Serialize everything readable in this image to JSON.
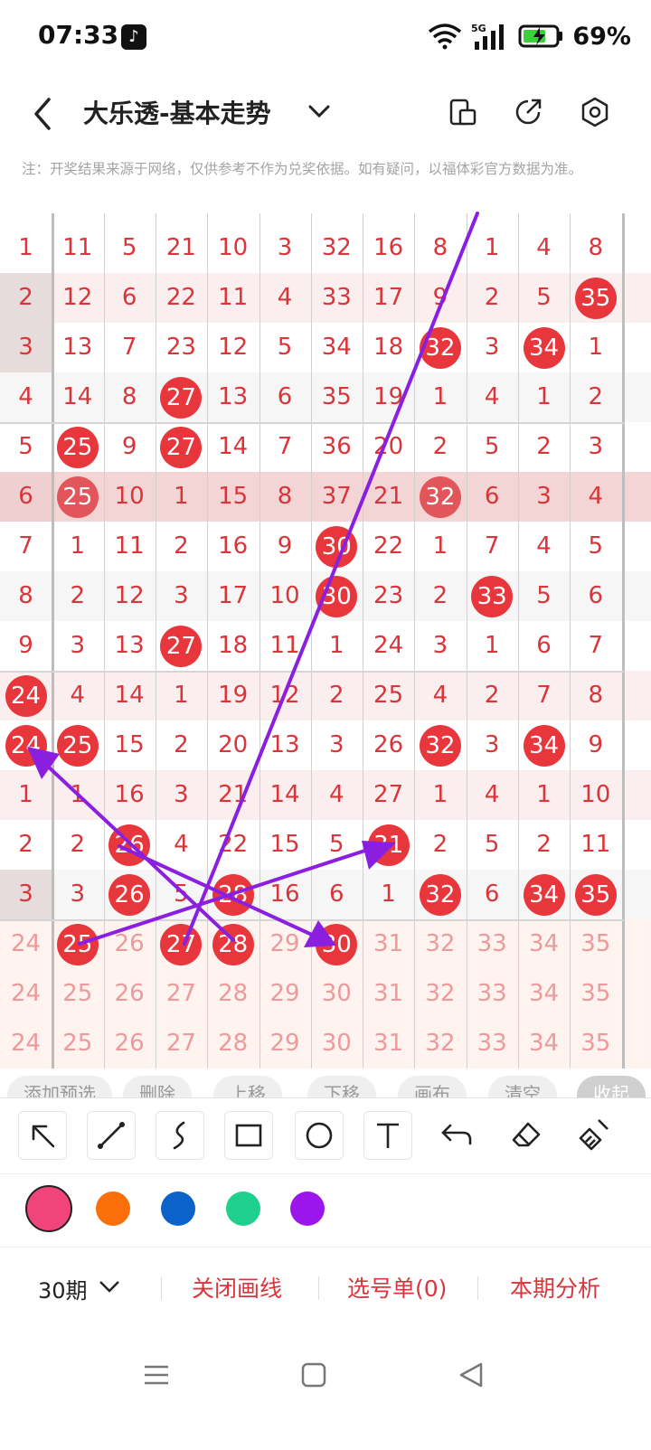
{
  "status": {
    "time": "07:33",
    "battery": "69%",
    "network": "5G"
  },
  "header": {
    "title": "大乐透-基本走势"
  },
  "notice": "注：开奖结果来源于网络，仅供参考不作为兑奖依据。如有疑问，以福体彩官方数据为准。",
  "grid": {
    "rows": [
      [
        [
          "1",
          0
        ],
        [
          "11",
          0
        ],
        [
          "5",
          0
        ],
        [
          "21",
          0
        ],
        [
          "10",
          0
        ],
        [
          "3",
          0
        ],
        [
          "32",
          0
        ],
        [
          "16",
          0
        ],
        [
          "8",
          0
        ],
        [
          "1",
          0
        ],
        [
          "4",
          0
        ],
        [
          "8",
          0
        ]
      ],
      [
        [
          "2",
          0
        ],
        [
          "12",
          0
        ],
        [
          "6",
          0
        ],
        [
          "22",
          0
        ],
        [
          "11",
          0
        ],
        [
          "4",
          0
        ],
        [
          "33",
          0
        ],
        [
          "17",
          0
        ],
        [
          "9",
          0
        ],
        [
          "2",
          0
        ],
        [
          "5",
          0
        ],
        [
          "35",
          1
        ]
      ],
      [
        [
          "3",
          0
        ],
        [
          "13",
          0
        ],
        [
          "7",
          0
        ],
        [
          "23",
          0
        ],
        [
          "12",
          0
        ],
        [
          "5",
          0
        ],
        [
          "34",
          0
        ],
        [
          "18",
          0
        ],
        [
          "32",
          1
        ],
        [
          "3",
          0
        ],
        [
          "34",
          1
        ],
        [
          "1",
          0
        ]
      ],
      [
        [
          "4",
          0
        ],
        [
          "14",
          0
        ],
        [
          "8",
          0
        ],
        [
          "27",
          1
        ],
        [
          "13",
          0
        ],
        [
          "6",
          0
        ],
        [
          "35",
          0
        ],
        [
          "19",
          0
        ],
        [
          "1",
          0
        ],
        [
          "4",
          0
        ],
        [
          "1",
          0
        ],
        [
          "2",
          0
        ]
      ],
      [
        [
          "5",
          0
        ],
        [
          "25",
          1
        ],
        [
          "9",
          0
        ],
        [
          "27",
          1
        ],
        [
          "14",
          0
        ],
        [
          "7",
          0
        ],
        [
          "36",
          0
        ],
        [
          "20",
          0
        ],
        [
          "2",
          0
        ],
        [
          "5",
          0
        ],
        [
          "2",
          0
        ],
        [
          "3",
          0
        ]
      ],
      [
        [
          "6",
          0
        ],
        [
          "25",
          1
        ],
        [
          "10",
          0
        ],
        [
          "1",
          0
        ],
        [
          "15",
          0
        ],
        [
          "8",
          0
        ],
        [
          "37",
          0
        ],
        [
          "21",
          0
        ],
        [
          "32",
          1
        ],
        [
          "6",
          0
        ],
        [
          "3",
          0
        ],
        [
          "4",
          0
        ]
      ],
      [
        [
          "7",
          0
        ],
        [
          "1",
          0
        ],
        [
          "11",
          0
        ],
        [
          "2",
          0
        ],
        [
          "16",
          0
        ],
        [
          "9",
          0
        ],
        [
          "30",
          1
        ],
        [
          "22",
          0
        ],
        [
          "1",
          0
        ],
        [
          "7",
          0
        ],
        [
          "4",
          0
        ],
        [
          "5",
          0
        ]
      ],
      [
        [
          "8",
          0
        ],
        [
          "2",
          0
        ],
        [
          "12",
          0
        ],
        [
          "3",
          0
        ],
        [
          "17",
          0
        ],
        [
          "10",
          0
        ],
        [
          "30",
          1
        ],
        [
          "23",
          0
        ],
        [
          "2",
          0
        ],
        [
          "33",
          1
        ],
        [
          "5",
          0
        ],
        [
          "6",
          0
        ]
      ],
      [
        [
          "9",
          0
        ],
        [
          "3",
          0
        ],
        [
          "13",
          0
        ],
        [
          "27",
          1
        ],
        [
          "18",
          0
        ],
        [
          "11",
          0
        ],
        [
          "1",
          0
        ],
        [
          "24",
          0
        ],
        [
          "3",
          0
        ],
        [
          "1",
          0
        ],
        [
          "6",
          0
        ],
        [
          "7",
          0
        ]
      ],
      [
        [
          "24",
          1
        ],
        [
          "4",
          0
        ],
        [
          "14",
          0
        ],
        [
          "1",
          0
        ],
        [
          "19",
          0
        ],
        [
          "12",
          0
        ],
        [
          "2",
          0
        ],
        [
          "25",
          0
        ],
        [
          "4",
          0
        ],
        [
          "2",
          0
        ],
        [
          "7",
          0
        ],
        [
          "8",
          0
        ]
      ],
      [
        [
          "24",
          1
        ],
        [
          "25",
          1
        ],
        [
          "15",
          0
        ],
        [
          "2",
          0
        ],
        [
          "20",
          0
        ],
        [
          "13",
          0
        ],
        [
          "3",
          0
        ],
        [
          "26",
          0
        ],
        [
          "32",
          1
        ],
        [
          "3",
          0
        ],
        [
          "34",
          1
        ],
        [
          "9",
          0
        ]
      ],
      [
        [
          "1",
          0
        ],
        [
          "1",
          0
        ],
        [
          "16",
          0
        ],
        [
          "3",
          0
        ],
        [
          "21",
          0
        ],
        [
          "14",
          0
        ],
        [
          "4",
          0
        ],
        [
          "27",
          0
        ],
        [
          "1",
          0
        ],
        [
          "4",
          0
        ],
        [
          "1",
          0
        ],
        [
          "10",
          0
        ]
      ],
      [
        [
          "2",
          0
        ],
        [
          "2",
          0
        ],
        [
          "26",
          1
        ],
        [
          "4",
          0
        ],
        [
          "22",
          0
        ],
        [
          "15",
          0
        ],
        [
          "5",
          0
        ],
        [
          "31",
          1
        ],
        [
          "2",
          0
        ],
        [
          "5",
          0
        ],
        [
          "2",
          0
        ],
        [
          "11",
          0
        ]
      ],
      [
        [
          "3",
          0
        ],
        [
          "3",
          0
        ],
        [
          "26",
          1
        ],
        [
          "5",
          0
        ],
        [
          "28",
          1
        ],
        [
          "16",
          0
        ],
        [
          "6",
          0
        ],
        [
          "1",
          0
        ],
        [
          "32",
          1
        ],
        [
          "6",
          0
        ],
        [
          "34",
          1
        ],
        [
          "35",
          1
        ]
      ],
      [
        [
          "24",
          2
        ],
        [
          "25",
          1
        ],
        [
          "26",
          2
        ],
        [
          "27",
          1
        ],
        [
          "28",
          1
        ],
        [
          "29",
          2
        ],
        [
          "30",
          1
        ],
        [
          "31",
          2
        ],
        [
          "32",
          2
        ],
        [
          "33",
          2
        ],
        [
          "34",
          2
        ],
        [
          "35",
          2
        ]
      ],
      [
        [
          "24",
          2
        ],
        [
          "25",
          2
        ],
        [
          "26",
          2
        ],
        [
          "27",
          2
        ],
        [
          "28",
          2
        ],
        [
          "29",
          2
        ],
        [
          "30",
          2
        ],
        [
          "31",
          2
        ],
        [
          "32",
          2
        ],
        [
          "33",
          2
        ],
        [
          "34",
          2
        ],
        [
          "35",
          2
        ]
      ],
      [
        [
          "24",
          2
        ],
        [
          "25",
          2
        ],
        [
          "26",
          2
        ],
        [
          "27",
          2
        ],
        [
          "28",
          2
        ],
        [
          "29",
          2
        ],
        [
          "30",
          2
        ],
        [
          "31",
          2
        ],
        [
          "32",
          2
        ],
        [
          "33",
          2
        ],
        [
          "34",
          2
        ],
        [
          "35",
          2
        ]
      ]
    ]
  },
  "chips": [
    "添加预选",
    "删除",
    "上移",
    "下移",
    "画布",
    "清空",
    "收起"
  ],
  "tools": [
    "arrow-tool",
    "line-tool",
    "curve-tool",
    "rectangle-tool",
    "circle-tool",
    "text-tool",
    "undo-tool",
    "eraser-tool",
    "clear-tool"
  ],
  "colors": [
    "#f0447a",
    "#fb6f0a",
    "#0b62c9",
    "#1fcf8e",
    "#9a16ea"
  ],
  "bottom": {
    "period": "30期",
    "close_draw": "关闭画线",
    "pick_list": "选号单(0)",
    "analysis": "本期分析"
  }
}
